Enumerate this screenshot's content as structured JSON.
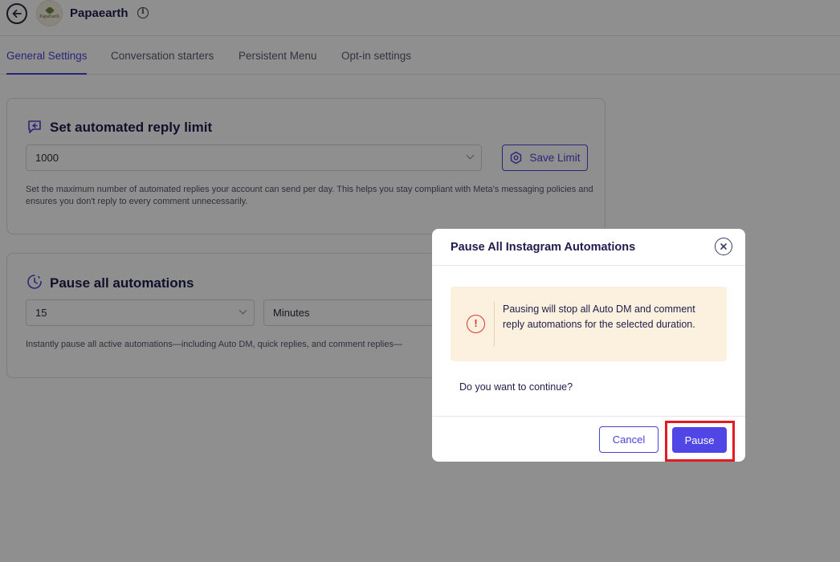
{
  "header": {
    "title": "Papaearth",
    "avatar_text": "PapaEarth"
  },
  "tabs": [
    {
      "label": "General Settings",
      "active": true
    },
    {
      "label": "Conversation starters",
      "active": false
    },
    {
      "label": "Persistent Menu",
      "active": false
    },
    {
      "label": "Opt-in settings",
      "active": false
    }
  ],
  "reply_limit": {
    "title": "Set automated reply limit",
    "value": "1000",
    "save_label": "Save Limit",
    "help": "Set the maximum number of automated replies your account can send per day. This helps you stay compliant with Meta's messaging policies and ensures you don't reply to every comment unnecessarily."
  },
  "pause_section": {
    "title": "Pause all automations",
    "duration_value": "15",
    "unit_value": "Minutes",
    "help": "Instantly pause all active automations—including Auto DM, quick replies, and comment replies—"
  },
  "modal": {
    "title": "Pause All Instagram Automations",
    "warning": "Pausing will stop all Auto DM and comment reply automations for the selected duration.",
    "question": "Do you want to continue?",
    "cancel_label": "Cancel",
    "pause_label": "Pause"
  },
  "colors": {
    "accent": "#4f46e5",
    "warning_bg": "#fbf1de",
    "warning_icon": "#e0312f",
    "highlight": "#e01b24"
  }
}
